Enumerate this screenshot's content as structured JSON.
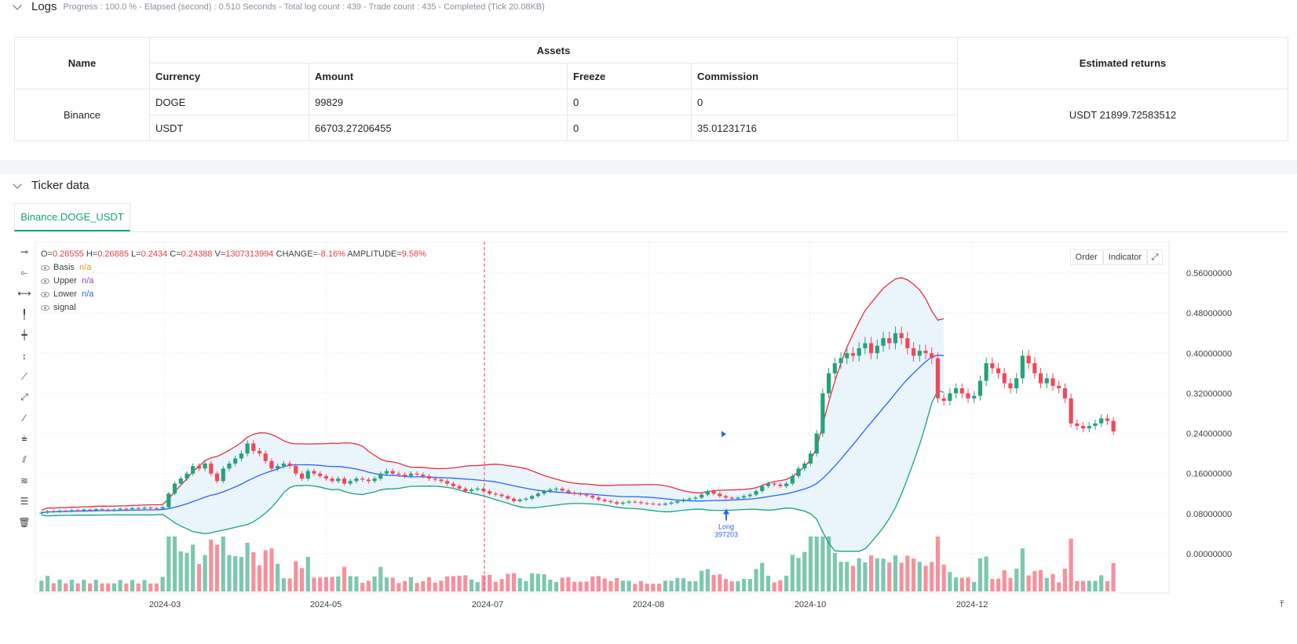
{
  "logs": {
    "title": "Logs",
    "progress": "Progress : 100.0 % - Elapsed (second) : 0.510  Seconds - Total log count : 439 - Trade count : 435 - Completed (Tick 20.08KB)"
  },
  "assets_table": {
    "name_header": "Name",
    "assets_header": "Assets",
    "returns_header": "Estimated returns",
    "columns": [
      "Currency",
      "Amount",
      "Freeze",
      "Commission"
    ],
    "exchange": "Binance",
    "rows": [
      {
        "currency": "DOGE",
        "amount": "99829",
        "freeze": "0",
        "commission": "0"
      },
      {
        "currency": "USDT",
        "amount": "66703.27206455",
        "freeze": "0",
        "commission": "35.01231716"
      }
    ],
    "estimated_returns": "USDT 21899.72583512"
  },
  "ticker": {
    "title": "Ticker data",
    "tab_label": "Binance.DOGE_USDT"
  },
  "chart_legend": {
    "ohlc_labels": {
      "o": "O=",
      "h": "H=",
      "l": "L=",
      "c": "C=",
      "v": "V=",
      "change": "CHANGE=",
      "amplitude": "AMPLITUDE="
    },
    "ohlc_values": {
      "o": "0.26555",
      "h": "0.26885",
      "l": "0.2434",
      "c": "0.24388",
      "v": "1307313994",
      "change": "-8.16%",
      "amplitude": "9.58%"
    },
    "series": [
      {
        "name": "Basis",
        "value": "n/a",
        "color": "#f7931a"
      },
      {
        "name": "Upper",
        "value": "n/a",
        "color": "#8e44ad"
      },
      {
        "name": "Lower",
        "value": "n/a",
        "color": "#2962ff"
      },
      {
        "name": "signal",
        "value": "",
        "color": "#3a3f47"
      }
    ]
  },
  "chart_buttons": {
    "order": "Order",
    "indicator": "Indicator"
  },
  "chart_data": {
    "type": "candlestick",
    "y_ticks": [
      "0.56000000",
      "0.48000000",
      "0.40000000",
      "0.32000000",
      "0.24000000",
      "0.16000000",
      "0.08000000",
      "0.00000000"
    ],
    "x_ticks": [
      "2024-03",
      "2024-05",
      "2024-07",
      "2024-08",
      "2024-10",
      "2024-12"
    ],
    "ylim": [
      0,
      0.56
    ],
    "colors": {
      "up": "#26a17b",
      "down": "#f0485a",
      "upper": "#e52e42",
      "basis": "#2962ff",
      "lower": "#14a37f",
      "band_fill": "#e8f3fb"
    },
    "annotation": {
      "label": "Long",
      "value": "397203",
      "price": 0.09
    },
    "closes": [
      0.082,
      0.085,
      0.084,
      0.086,
      0.085,
      0.087,
      0.086,
      0.088,
      0.087,
      0.089,
      0.088,
      0.087,
      0.088,
      0.09,
      0.089,
      0.091,
      0.09,
      0.092,
      0.091,
      0.09,
      0.093,
      0.12,
      0.14,
      0.15,
      0.16,
      0.175,
      0.17,
      0.18,
      0.16,
      0.145,
      0.17,
      0.18,
      0.19,
      0.2,
      0.22,
      0.205,
      0.2,
      0.185,
      0.17,
      0.175,
      0.18,
      0.175,
      0.16,
      0.15,
      0.165,
      0.16,
      0.155,
      0.15,
      0.145,
      0.15,
      0.14,
      0.145,
      0.15,
      0.148,
      0.145,
      0.15,
      0.16,
      0.165,
      0.16,
      0.158,
      0.155,
      0.16,
      0.158,
      0.155,
      0.15,
      0.148,
      0.145,
      0.14,
      0.135,
      0.13,
      0.125,
      0.128,
      0.13,
      0.125,
      0.12,
      0.118,
      0.115,
      0.11,
      0.105,
      0.108,
      0.11,
      0.115,
      0.12,
      0.125,
      0.128,
      0.13,
      0.126,
      0.122,
      0.12,
      0.118,
      0.116,
      0.112,
      0.108,
      0.105,
      0.103,
      0.1,
      0.102,
      0.104,
      0.103,
      0.101,
      0.1,
      0.099,
      0.098,
      0.1,
      0.102,
      0.105,
      0.108,
      0.11,
      0.112,
      0.118,
      0.125,
      0.12,
      0.115,
      0.112,
      0.11,
      0.112,
      0.115,
      0.118,
      0.125,
      0.135,
      0.14,
      0.138,
      0.135,
      0.14,
      0.155,
      0.17,
      0.18,
      0.2,
      0.24,
      0.32,
      0.36,
      0.38,
      0.39,
      0.4,
      0.395,
      0.41,
      0.42,
      0.4,
      0.415,
      0.43,
      0.42,
      0.44,
      0.43,
      0.41,
      0.395,
      0.405,
      0.4,
      0.39,
      0.31,
      0.305,
      0.32,
      0.33,
      0.32,
      0.31,
      0.315,
      0.345,
      0.38,
      0.37,
      0.36,
      0.34,
      0.33,
      0.35,
      0.395,
      0.38,
      0.36,
      0.34,
      0.35,
      0.335,
      0.33,
      0.31,
      0.26,
      0.255,
      0.25,
      0.255,
      0.26,
      0.27,
      0.265,
      0.244
    ]
  }
}
